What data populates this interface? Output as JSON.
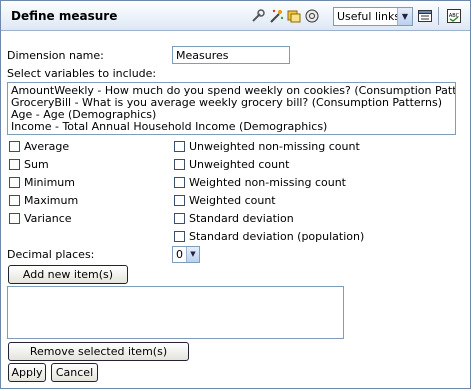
{
  "title": "Define measure",
  "toolbar": {
    "icons": [
      "wrench-icon",
      "magic-wand-icon",
      "copy-icon",
      "phone-icon",
      "grid-icon",
      "abc-icon"
    ],
    "useful_links": "Useful links"
  },
  "dimension": {
    "label": "Dimension name:",
    "value": "Measures"
  },
  "variables": {
    "label": "Select variables to include:",
    "items": [
      "AmountWeekly - How much do you spend weekly on cookies? (Consumption Patterns)",
      "GroceryBill - What is you average weekly grocery bill? (Consumption Patterns)",
      "Age - Age (Demographics)",
      "Income - Total Annual Household Income (Demographics)"
    ]
  },
  "stats_left": [
    "Average",
    "Sum",
    "Minimum",
    "Maximum",
    "Variance"
  ],
  "stats_right": [
    "Unweighted non-missing count",
    "Unweighted count",
    "Weighted non-missing count",
    "Weighted count",
    "Standard deviation",
    "Standard deviation (population)"
  ],
  "decimal": {
    "label": "Decimal places:",
    "value": "0"
  },
  "buttons": {
    "add": "Add new item(s)",
    "remove": "Remove selected item(s)",
    "apply": "Apply",
    "cancel": "Cancel"
  }
}
